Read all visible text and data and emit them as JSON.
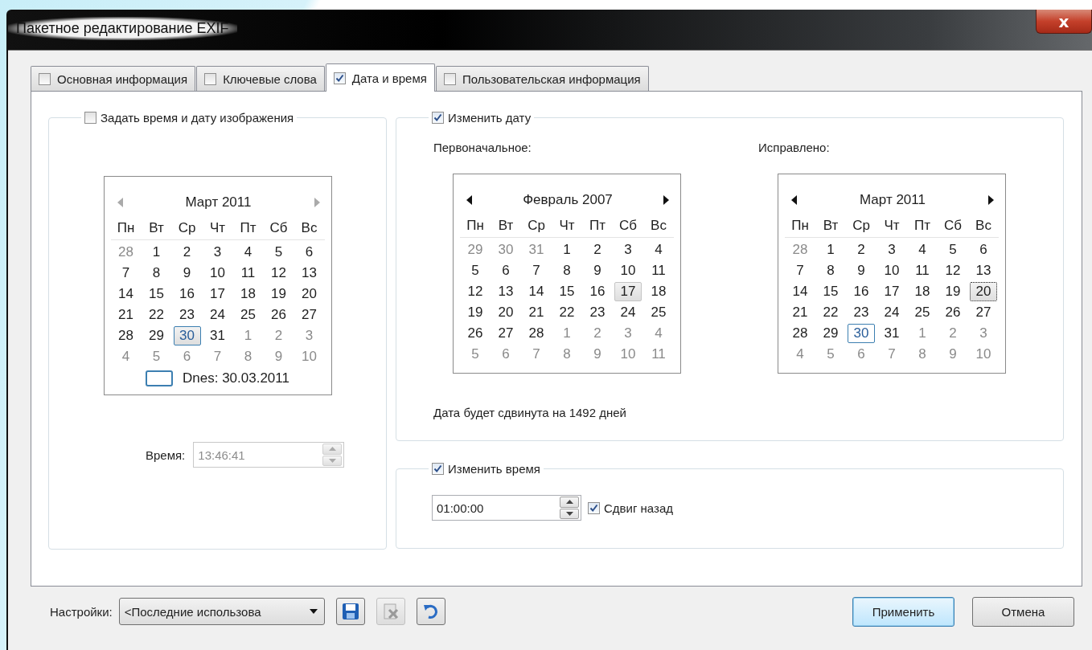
{
  "window": {
    "title": "Пакетное редактирование EXIF",
    "close": "x"
  },
  "tabs": [
    {
      "label": "Основная информация",
      "checked": false,
      "selected": false
    },
    {
      "label": "Ключевые слова",
      "checked": false,
      "selected": false
    },
    {
      "label": "Дата и время",
      "checked": true,
      "selected": true
    },
    {
      "label": "Пользовательская информация",
      "checked": false,
      "selected": false
    }
  ],
  "image_date": {
    "legend": "Задать время и дату изображения",
    "checked": false,
    "calendar": {
      "title": "Март 2011",
      "nav_enabled": false,
      "weekdays": [
        "Пн",
        "Вт",
        "Ср",
        "Чт",
        "Пт",
        "Сб",
        "Вс"
      ],
      "weeks": [
        [
          {
            "day": "28",
            "muted": true,
            "today": false,
            "selected": false,
            "focused": false
          },
          {
            "day": "1",
            "muted": false,
            "today": false,
            "selected": false,
            "focused": false
          },
          {
            "day": "2",
            "muted": false,
            "today": false,
            "selected": false,
            "focused": false
          },
          {
            "day": "3",
            "muted": false,
            "today": false,
            "selected": false,
            "focused": false
          },
          {
            "day": "4",
            "muted": false,
            "today": false,
            "selected": false,
            "focused": false
          },
          {
            "day": "5",
            "muted": false,
            "today": false,
            "selected": false,
            "focused": false
          },
          {
            "day": "6",
            "muted": false,
            "today": false,
            "selected": false,
            "focused": false
          }
        ],
        [
          {
            "day": "7",
            "muted": false,
            "today": false,
            "selected": false,
            "focused": false
          },
          {
            "day": "8",
            "muted": false,
            "today": false,
            "selected": false,
            "focused": false
          },
          {
            "day": "9",
            "muted": false,
            "today": false,
            "selected": false,
            "focused": false
          },
          {
            "day": "10",
            "muted": false,
            "today": false,
            "selected": false,
            "focused": false
          },
          {
            "day": "11",
            "muted": false,
            "today": false,
            "selected": false,
            "focused": false
          },
          {
            "day": "12",
            "muted": false,
            "today": false,
            "selected": false,
            "focused": false
          },
          {
            "day": "13",
            "muted": false,
            "today": false,
            "selected": false,
            "focused": false
          }
        ],
        [
          {
            "day": "14",
            "muted": false,
            "today": false,
            "selected": false,
            "focused": false
          },
          {
            "day": "15",
            "muted": false,
            "today": false,
            "selected": false,
            "focused": false
          },
          {
            "day": "16",
            "muted": false,
            "today": false,
            "selected": false,
            "focused": false
          },
          {
            "day": "17",
            "muted": false,
            "today": false,
            "selected": false,
            "focused": false
          },
          {
            "day": "18",
            "muted": false,
            "today": false,
            "selected": false,
            "focused": false
          },
          {
            "day": "19",
            "muted": false,
            "today": false,
            "selected": false,
            "focused": false
          },
          {
            "day": "20",
            "muted": false,
            "today": false,
            "selected": false,
            "focused": false
          }
        ],
        [
          {
            "day": "21",
            "muted": false,
            "today": false,
            "selected": false,
            "focused": false
          },
          {
            "day": "22",
            "muted": false,
            "today": false,
            "selected": false,
            "focused": false
          },
          {
            "day": "23",
            "muted": false,
            "today": false,
            "selected": false,
            "focused": false
          },
          {
            "day": "24",
            "muted": false,
            "today": false,
            "selected": false,
            "focused": false
          },
          {
            "day": "25",
            "muted": false,
            "today": false,
            "selected": false,
            "focused": false
          },
          {
            "day": "26",
            "muted": false,
            "today": false,
            "selected": false,
            "focused": false
          },
          {
            "day": "27",
            "muted": false,
            "today": false,
            "selected": false,
            "focused": false
          }
        ],
        [
          {
            "day": "28",
            "muted": false,
            "today": false,
            "selected": false,
            "focused": false
          },
          {
            "day": "29",
            "muted": false,
            "today": false,
            "selected": false,
            "focused": false
          },
          {
            "day": "30",
            "muted": false,
            "today": true,
            "selected": true,
            "focused": false
          },
          {
            "day": "31",
            "muted": false,
            "today": false,
            "selected": false,
            "focused": false
          },
          {
            "day": "1",
            "muted": true,
            "today": false,
            "selected": false,
            "focused": false
          },
          {
            "day": "2",
            "muted": true,
            "today": false,
            "selected": false,
            "focused": false
          },
          {
            "day": "3",
            "muted": true,
            "today": false,
            "selected": false,
            "focused": false
          }
        ],
        [
          {
            "day": "4",
            "muted": true,
            "today": false,
            "selected": false,
            "focused": false
          },
          {
            "day": "5",
            "muted": true,
            "today": false,
            "selected": false,
            "focused": false
          },
          {
            "day": "6",
            "muted": true,
            "today": false,
            "selected": false,
            "focused": false
          },
          {
            "day": "7",
            "muted": true,
            "today": false,
            "selected": false,
            "focused": false
          },
          {
            "day": "8",
            "muted": true,
            "today": false,
            "selected": false,
            "focused": false
          },
          {
            "day": "9",
            "muted": true,
            "today": false,
            "selected": false,
            "focused": false
          },
          {
            "day": "10",
            "muted": true,
            "today": false,
            "selected": false,
            "focused": false
          }
        ]
      ],
      "today_label": "Dnes: 30.03.2011"
    },
    "time_label": "Время:",
    "time_value": "13:46:41",
    "time_disabled": true
  },
  "change_date": {
    "legend": "Изменить дату",
    "checked": true,
    "original_label": "Первоначальное:",
    "corrected_label": "Исправлено:",
    "original_calendar": {
      "title": "Февраль 2007",
      "nav_enabled": true,
      "weekdays": [
        "Пн",
        "Вт",
        "Ср",
        "Чт",
        "Пт",
        "Сб",
        "Вс"
      ],
      "weeks": [
        [
          {
            "day": "29",
            "muted": true,
            "today": false,
            "selected": false,
            "focused": false
          },
          {
            "day": "30",
            "muted": true,
            "today": false,
            "selected": false,
            "focused": false
          },
          {
            "day": "31",
            "muted": true,
            "today": false,
            "selected": false,
            "focused": false
          },
          {
            "day": "1",
            "muted": false,
            "today": false,
            "selected": false,
            "focused": false
          },
          {
            "day": "2",
            "muted": false,
            "today": false,
            "selected": false,
            "focused": false
          },
          {
            "day": "3",
            "muted": false,
            "today": false,
            "selected": false,
            "focused": false
          },
          {
            "day": "4",
            "muted": false,
            "today": false,
            "selected": false,
            "focused": false
          }
        ],
        [
          {
            "day": "5",
            "muted": false,
            "today": false,
            "selected": false,
            "focused": false
          },
          {
            "day": "6",
            "muted": false,
            "today": false,
            "selected": false,
            "focused": false
          },
          {
            "day": "7",
            "muted": false,
            "today": false,
            "selected": false,
            "focused": false
          },
          {
            "day": "8",
            "muted": false,
            "today": false,
            "selected": false,
            "focused": false
          },
          {
            "day": "9",
            "muted": false,
            "today": false,
            "selected": false,
            "focused": false
          },
          {
            "day": "10",
            "muted": false,
            "today": false,
            "selected": false,
            "focused": false
          },
          {
            "day": "11",
            "muted": false,
            "today": false,
            "selected": false,
            "focused": false
          }
        ],
        [
          {
            "day": "12",
            "muted": false,
            "today": false,
            "selected": false,
            "focused": false
          },
          {
            "day": "13",
            "muted": false,
            "today": false,
            "selected": false,
            "focused": false
          },
          {
            "day": "14",
            "muted": false,
            "today": false,
            "selected": false,
            "focused": false
          },
          {
            "day": "15",
            "muted": false,
            "today": false,
            "selected": false,
            "focused": false
          },
          {
            "day": "16",
            "muted": false,
            "today": false,
            "selected": false,
            "focused": false
          },
          {
            "day": "17",
            "muted": false,
            "today": false,
            "selected": true,
            "focused": false
          },
          {
            "day": "18",
            "muted": false,
            "today": false,
            "selected": false,
            "focused": false
          }
        ],
        [
          {
            "day": "19",
            "muted": false,
            "today": false,
            "selected": false,
            "focused": false
          },
          {
            "day": "20",
            "muted": false,
            "today": false,
            "selected": false,
            "focused": false
          },
          {
            "day": "21",
            "muted": false,
            "today": false,
            "selected": false,
            "focused": false
          },
          {
            "day": "22",
            "muted": false,
            "today": false,
            "selected": false,
            "focused": false
          },
          {
            "day": "23",
            "muted": false,
            "today": false,
            "selected": false,
            "focused": false
          },
          {
            "day": "24",
            "muted": false,
            "today": false,
            "selected": false,
            "focused": false
          },
          {
            "day": "25",
            "muted": false,
            "today": false,
            "selected": false,
            "focused": false
          }
        ],
        [
          {
            "day": "26",
            "muted": false,
            "today": false,
            "selected": false,
            "focused": false
          },
          {
            "day": "27",
            "muted": false,
            "today": false,
            "selected": false,
            "focused": false
          },
          {
            "day": "28",
            "muted": false,
            "today": false,
            "selected": false,
            "focused": false
          },
          {
            "day": "1",
            "muted": true,
            "today": false,
            "selected": false,
            "focused": false
          },
          {
            "day": "2",
            "muted": true,
            "today": false,
            "selected": false,
            "focused": false
          },
          {
            "day": "3",
            "muted": true,
            "today": false,
            "selected": false,
            "focused": false
          },
          {
            "day": "4",
            "muted": true,
            "today": false,
            "selected": false,
            "focused": false
          }
        ],
        [
          {
            "day": "5",
            "muted": true,
            "today": false,
            "selected": false,
            "focused": false
          },
          {
            "day": "6",
            "muted": true,
            "today": false,
            "selected": false,
            "focused": false
          },
          {
            "day": "7",
            "muted": true,
            "today": false,
            "selected": false,
            "focused": false
          },
          {
            "day": "8",
            "muted": true,
            "today": false,
            "selected": false,
            "focused": false
          },
          {
            "day": "9",
            "muted": true,
            "today": false,
            "selected": false,
            "focused": false
          },
          {
            "day": "10",
            "muted": true,
            "today": false,
            "selected": false,
            "focused": false
          },
          {
            "day": "11",
            "muted": true,
            "today": false,
            "selected": false,
            "focused": false
          }
        ]
      ]
    },
    "corrected_calendar": {
      "title": "Март 2011",
      "nav_enabled": true,
      "weekdays": [
        "Пн",
        "Вт",
        "Ср",
        "Чт",
        "Пт",
        "Сб",
        "Вс"
      ],
      "weeks": [
        [
          {
            "day": "28",
            "muted": true,
            "today": false,
            "selected": false,
            "focused": false
          },
          {
            "day": "1",
            "muted": false,
            "today": false,
            "selected": false,
            "focused": false
          },
          {
            "day": "2",
            "muted": false,
            "today": false,
            "selected": false,
            "focused": false
          },
          {
            "day": "3",
            "muted": false,
            "today": false,
            "selected": false,
            "focused": false
          },
          {
            "day": "4",
            "muted": false,
            "today": false,
            "selected": false,
            "focused": false
          },
          {
            "day": "5",
            "muted": false,
            "today": false,
            "selected": false,
            "focused": false
          },
          {
            "day": "6",
            "muted": false,
            "today": false,
            "selected": false,
            "focused": false
          }
        ],
        [
          {
            "day": "7",
            "muted": false,
            "today": false,
            "selected": false,
            "focused": false
          },
          {
            "day": "8",
            "muted": false,
            "today": false,
            "selected": false,
            "focused": false
          },
          {
            "day": "9",
            "muted": false,
            "today": false,
            "selected": false,
            "focused": false
          },
          {
            "day": "10",
            "muted": false,
            "today": false,
            "selected": false,
            "focused": false
          },
          {
            "day": "11",
            "muted": false,
            "today": false,
            "selected": false,
            "focused": false
          },
          {
            "day": "12",
            "muted": false,
            "today": false,
            "selected": false,
            "focused": false
          },
          {
            "day": "13",
            "muted": false,
            "today": false,
            "selected": false,
            "focused": false
          }
        ],
        [
          {
            "day": "14",
            "muted": false,
            "today": false,
            "selected": false,
            "focused": false
          },
          {
            "day": "15",
            "muted": false,
            "today": false,
            "selected": false,
            "focused": false
          },
          {
            "day": "16",
            "muted": false,
            "today": false,
            "selected": false,
            "focused": false
          },
          {
            "day": "17",
            "muted": false,
            "today": false,
            "selected": false,
            "focused": false
          },
          {
            "day": "18",
            "muted": false,
            "today": false,
            "selected": false,
            "focused": false
          },
          {
            "day": "19",
            "muted": false,
            "today": false,
            "selected": false,
            "focused": false
          },
          {
            "day": "20",
            "muted": false,
            "today": false,
            "selected": true,
            "focused": true
          }
        ],
        [
          {
            "day": "21",
            "muted": false,
            "today": false,
            "selected": false,
            "focused": false
          },
          {
            "day": "22",
            "muted": false,
            "today": false,
            "selected": false,
            "focused": false
          },
          {
            "day": "23",
            "muted": false,
            "today": false,
            "selected": false,
            "focused": false
          },
          {
            "day": "24",
            "muted": false,
            "today": false,
            "selected": false,
            "focused": false
          },
          {
            "day": "25",
            "muted": false,
            "today": false,
            "selected": false,
            "focused": false
          },
          {
            "day": "26",
            "muted": false,
            "today": false,
            "selected": false,
            "focused": false
          },
          {
            "day": "27",
            "muted": false,
            "today": false,
            "selected": false,
            "focused": false
          }
        ],
        [
          {
            "day": "28",
            "muted": false,
            "today": false,
            "selected": false,
            "focused": false
          },
          {
            "day": "29",
            "muted": false,
            "today": false,
            "selected": false,
            "focused": false
          },
          {
            "day": "30",
            "muted": false,
            "today": true,
            "selected": false,
            "focused": false
          },
          {
            "day": "31",
            "muted": false,
            "today": false,
            "selected": false,
            "focused": false
          },
          {
            "day": "1",
            "muted": true,
            "today": false,
            "selected": false,
            "focused": false
          },
          {
            "day": "2",
            "muted": true,
            "today": false,
            "selected": false,
            "focused": false
          },
          {
            "day": "3",
            "muted": true,
            "today": false,
            "selected": false,
            "focused": false
          }
        ],
        [
          {
            "day": "4",
            "muted": true,
            "today": false,
            "selected": false,
            "focused": false
          },
          {
            "day": "5",
            "muted": true,
            "today": false,
            "selected": false,
            "focused": false
          },
          {
            "day": "6",
            "muted": true,
            "today": false,
            "selected": false,
            "focused": false
          },
          {
            "day": "7",
            "muted": true,
            "today": false,
            "selected": false,
            "focused": false
          },
          {
            "day": "8",
            "muted": true,
            "today": false,
            "selected": false,
            "focused": false
          },
          {
            "day": "9",
            "muted": true,
            "today": false,
            "selected": false,
            "focused": false
          },
          {
            "day": "10",
            "muted": true,
            "today": false,
            "selected": false,
            "focused": false
          }
        ]
      ]
    },
    "shift_text": "Дата будет сдвинута на 1492 дней"
  },
  "change_time": {
    "legend": "Изменить время",
    "checked": true,
    "value": "01:00:00",
    "backward_label": "Сдвиг назад",
    "backward_checked": true
  },
  "footer": {
    "presets_label": "Настройки:",
    "preset_value": "<Последние использова",
    "apply": "Применить",
    "cancel": "Отмена"
  }
}
